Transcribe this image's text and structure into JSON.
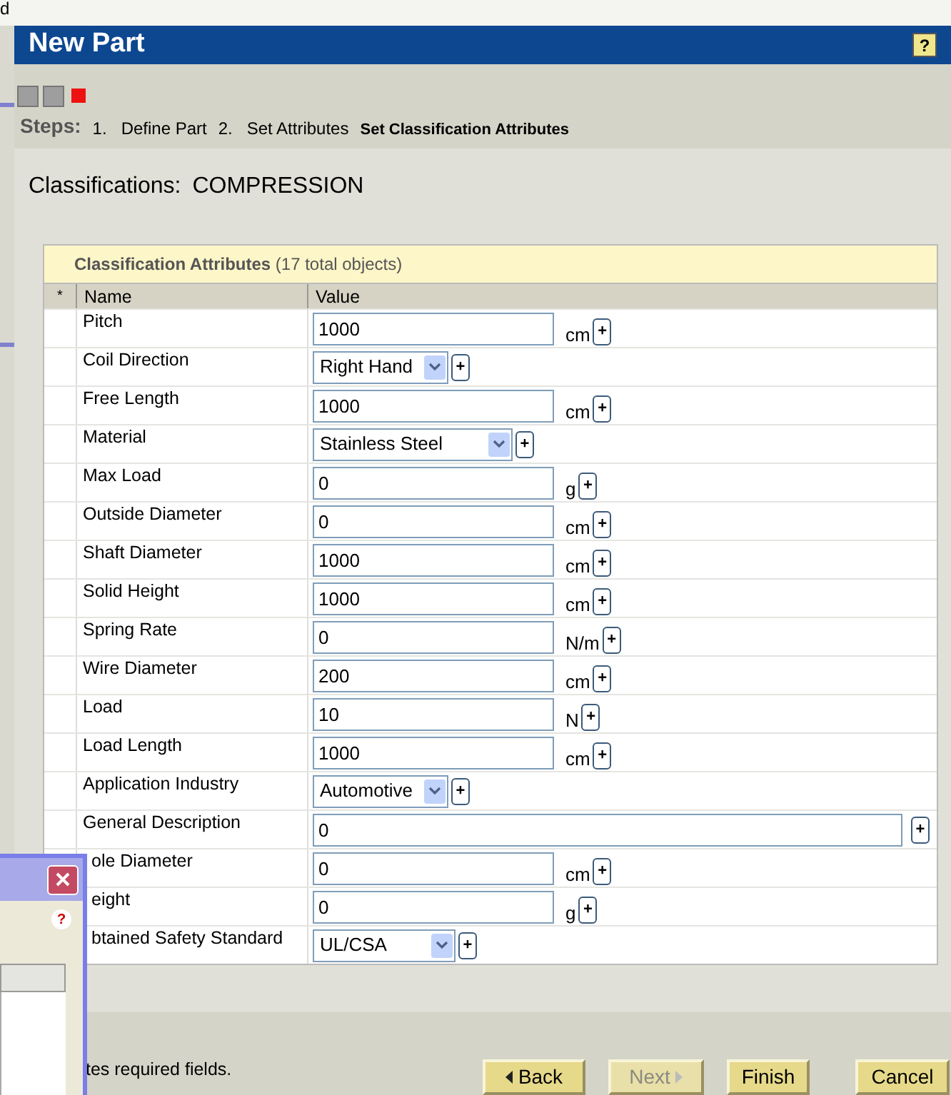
{
  "background": {
    "text": "d"
  },
  "window": {
    "title": "New Part",
    "help": "?"
  },
  "steps": {
    "label": "Steps:",
    "items": [
      {
        "number": "1.",
        "label": "Define Part",
        "selected": false
      },
      {
        "number": "2.",
        "label": "Set Attributes",
        "selected": false
      },
      {
        "label": "Set Classification Attributes",
        "selected": true
      }
    ]
  },
  "classification": {
    "label": "Classifications:",
    "value": "COMPRESSION"
  },
  "table": {
    "title": "Classification Attributes",
    "count": "(17 total objects)",
    "columns": [
      "*",
      "Name",
      "Value"
    ],
    "rows": [
      {
        "name": "Pitch",
        "kind": "text",
        "value": "1000",
        "unit": "cm",
        "add": "+"
      },
      {
        "name": "Coil Direction",
        "kind": "select",
        "value": "Right Hand",
        "add": "+"
      },
      {
        "name": "Free Length",
        "kind": "text",
        "value": "1000",
        "unit": "cm",
        "add": "+"
      },
      {
        "name": "Material",
        "kind": "select",
        "value": "Stainless Steel",
        "add": "+"
      },
      {
        "name": "Max Load",
        "kind": "text",
        "value": "0",
        "unit": "g",
        "add": "+"
      },
      {
        "name": "Outside Diameter",
        "kind": "text",
        "value": "0",
        "unit": "cm",
        "add": "+"
      },
      {
        "name": "Shaft Diameter",
        "kind": "text",
        "value": "1000",
        "unit": "cm",
        "add": "+"
      },
      {
        "name": "Solid Height",
        "kind": "text",
        "value": "1000",
        "unit": "cm",
        "add": "+"
      },
      {
        "name": "Spring Rate",
        "kind": "text",
        "value": "0",
        "unit": "N/m",
        "add": "+"
      },
      {
        "name": "Wire Diameter",
        "kind": "text",
        "value": "200",
        "unit": "cm",
        "add": "+"
      },
      {
        "name": "Load",
        "kind": "text",
        "value": "10",
        "unit": "N",
        "add": "+"
      },
      {
        "name": "Load Length",
        "kind": "text",
        "value": "1000",
        "unit": "cm",
        "add": "+"
      },
      {
        "name": "Application Industry",
        "kind": "select",
        "value": "Automotive",
        "add": "+"
      },
      {
        "name": "General Description",
        "kind": "wide",
        "value": "0",
        "add": "+"
      },
      {
        "name": "ole Diameter",
        "kind": "text",
        "value": "0",
        "unit": "cm",
        "add": "+"
      },
      {
        "name": "eight",
        "kind": "text",
        "value": "0",
        "unit": "g",
        "add": "+"
      },
      {
        "name": "btained Safety Standard",
        "kind": "select",
        "value": "UL/CSA",
        "add": "+"
      }
    ]
  },
  "footer_note": "tes required fields.",
  "buttons": [
    {
      "label": "Back",
      "kind": "back",
      "disabled": false
    },
    {
      "label": "Next",
      "kind": "next",
      "disabled": true
    },
    {
      "label": "Finish",
      "kind": "plain",
      "disabled": false
    },
    {
      "label": "Cancel",
      "kind": "plain",
      "disabled": false
    }
  ],
  "dialog": {
    "help": "?"
  }
}
